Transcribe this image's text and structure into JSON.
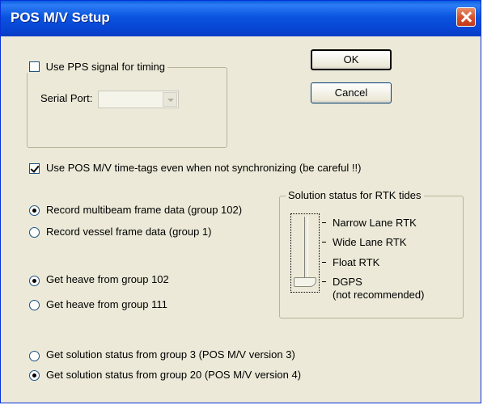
{
  "window": {
    "title": "POS M/V Setup"
  },
  "pps": {
    "checkbox_label": "Use PPS signal for timing",
    "checked": false,
    "serial_port_label": "Serial Port:",
    "serial_port_value": ""
  },
  "buttons": {
    "ok": "OK",
    "cancel": "Cancel"
  },
  "timetags": {
    "label": "Use POS M/V time-tags even when not synchronizing (be careful !!)",
    "checked": true
  },
  "frame_data": {
    "options": [
      "Record multibeam frame data (group 102)",
      "Record vessel frame data (group 1)"
    ],
    "selected": 0
  },
  "heave": {
    "options": [
      "Get heave from group 102",
      "Get heave from group 111"
    ],
    "selected": 0
  },
  "solution_status": {
    "options": [
      "Get solution status from group 3 (POS M/V version 3)",
      "Get solution status from group 20 (POS M/V version 4)"
    ],
    "selected": 1
  },
  "rtk": {
    "legend": "Solution status for RTK tides",
    "levels": [
      "Narrow Lane RTK",
      "Wide Lane RTK",
      "Float RTK",
      "DGPS",
      "(not recommended)"
    ],
    "selected": "DGPS"
  },
  "colors": {
    "titlebar": "#0a54df",
    "dialog_bg": "#ece9d8",
    "close_button": "#d5502b"
  }
}
